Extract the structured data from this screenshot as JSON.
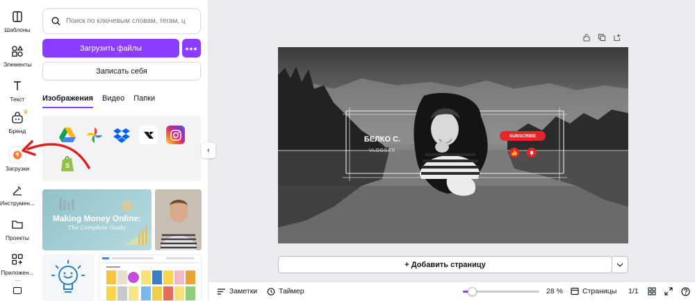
{
  "rail": {
    "items": [
      {
        "label": "Шаблоны",
        "icon": "templates-icon"
      },
      {
        "label": "Элементы",
        "icon": "elements-icon"
      },
      {
        "label": "Текст",
        "icon": "text-icon"
      },
      {
        "label": "Бренд",
        "icon": "brand-icon"
      },
      {
        "label": "Загрузки",
        "icon": "uploads-icon"
      },
      {
        "label": "Инструмен...",
        "icon": "tools-icon"
      },
      {
        "label": "Проекты",
        "icon": "projects-icon"
      },
      {
        "label": "Приложен...",
        "icon": "apps-icon"
      }
    ]
  },
  "panel": {
    "search_placeholder": "Поиск по ключевым словам, тегам, ц",
    "upload_label": "Загрузить файлы",
    "more_label": "•••",
    "record_label": "Записать себя",
    "tabs": [
      "Изображения",
      "Видео",
      "Папки"
    ],
    "apps": [
      "google-drive-icon",
      "google-photos-icon",
      "dropbox-icon",
      "box-icon",
      "instagram-icon",
      "shopify-icon"
    ],
    "thumb1": {
      "title": "Making Money Online:",
      "subtitle": "The Complete Guide"
    }
  },
  "design": {
    "name": "БЕЛКО С.",
    "role": "VLOGGER",
    "subscribe": "SUBSCRIBE"
  },
  "canvas": {
    "add_page_label": "+ Добавить страницу"
  },
  "footer": {
    "notes_label": "Заметки",
    "timer_label": "Таймер",
    "zoom": "28 %",
    "pages_label": "Страницы",
    "page_count": "1/1",
    "zoom_level": 0.12
  },
  "colors": {
    "accent": "#8b3dff",
    "subscribe": "#e4262b"
  }
}
